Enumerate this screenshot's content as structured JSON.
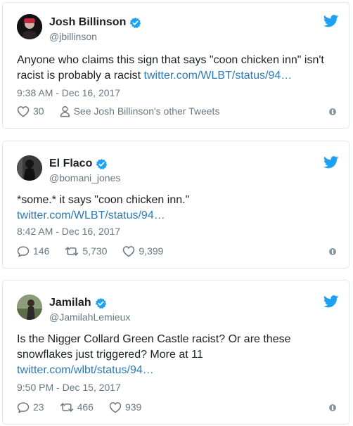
{
  "colors": {
    "link": "#2b7bb9",
    "muted": "#697882",
    "border": "#e1e8ed",
    "twitter_blue": "#1da1f2"
  },
  "tweets": [
    {
      "name": "Josh Billinson",
      "handle": "@jbillinson",
      "text": "Anyone who claims this sign that says \"coon chicken inn\" isn't racist is probably a racist ",
      "link": "twitter.com/WLBT/status/94…",
      "time": "9:38 AM - Dec 16, 2017",
      "likes": "30",
      "other": "See Josh Billinson's other Tweets"
    },
    {
      "name": "El Flaco",
      "handle": "@bomani_jones",
      "text": "*some.* it says \"coon chicken inn.\"",
      "link": "twitter.com/WLBT/status/94…",
      "time": "8:42 AM - Dec 16, 2017",
      "replies": "146",
      "retweets": "5,730",
      "likes": "9,399"
    },
    {
      "name": "Jamilah",
      "handle": "@JamilahLemieux",
      "text": "Is the Nigger Collard Green Castle racist? Or are these snowflakes just triggered? More at 11",
      "link": "twitter.com/wlbt/status/94…",
      "time": "9:50 PM - Dec 15, 2017",
      "replies": "23",
      "retweets": "466",
      "likes": "939"
    }
  ],
  "icons": [
    "verified-icon",
    "twitter-bird-icon",
    "heart-icon",
    "person-icon",
    "reply-icon",
    "retweet-icon",
    "info-icon"
  ]
}
